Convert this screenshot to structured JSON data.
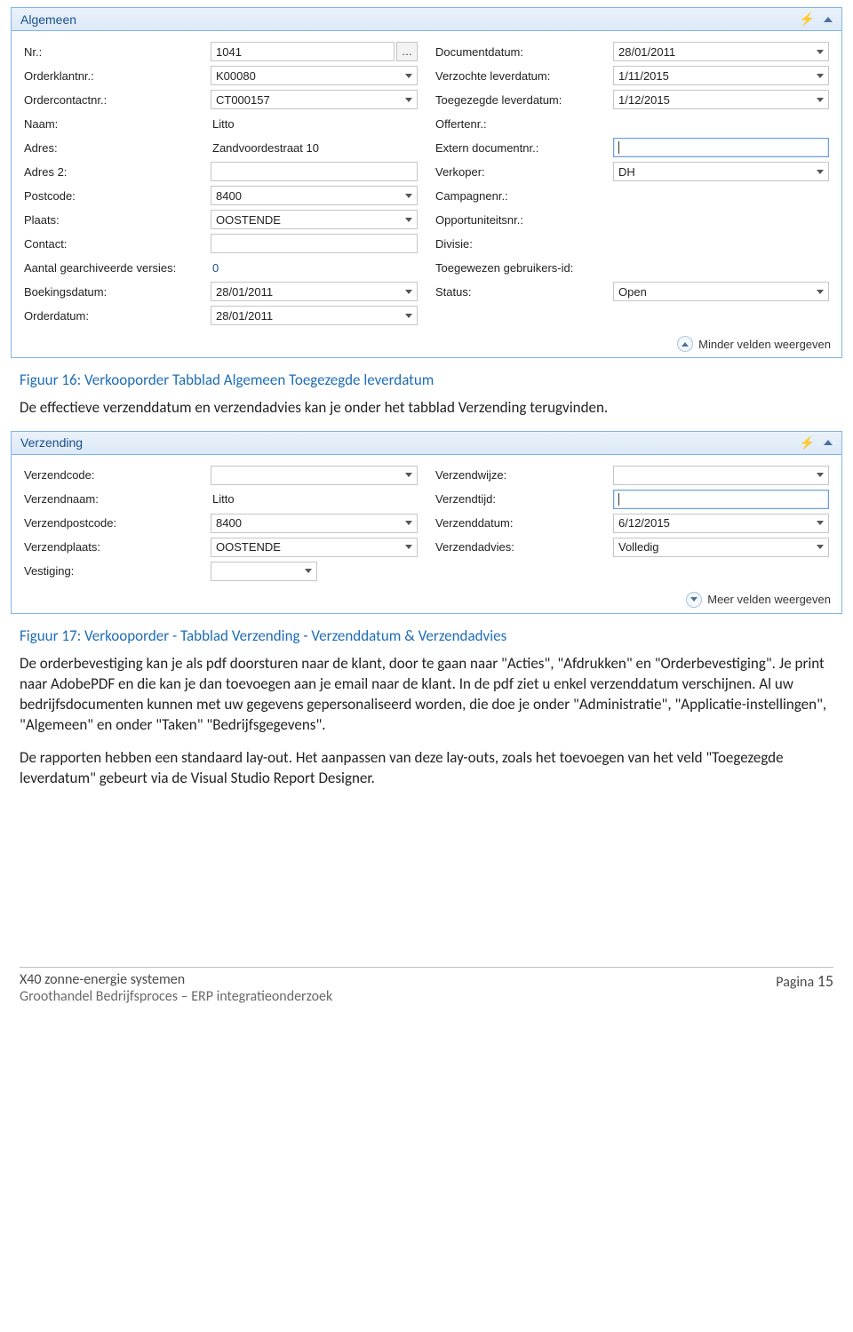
{
  "panel1": {
    "title": "Algemeen",
    "left": [
      {
        "label": "Nr.:",
        "value": "1041",
        "kind": "ellipsis-input"
      },
      {
        "label": "Orderklantnr.:",
        "value": "K00080",
        "kind": "dropdown"
      },
      {
        "label": "Ordercontactnr.:",
        "value": "CT000157",
        "kind": "dropdown"
      },
      {
        "label": "Naam:",
        "value": "Litto",
        "kind": "plain"
      },
      {
        "label": "Adres:",
        "value": "Zandvoordestraat 10",
        "kind": "plain"
      },
      {
        "label": "Adres 2:",
        "value": "",
        "kind": "input"
      },
      {
        "label": "Postcode:",
        "value": "8400",
        "kind": "dropdown"
      },
      {
        "label": "Plaats:",
        "value": "OOSTENDE",
        "kind": "dropdown"
      },
      {
        "label": "Contact:",
        "value": "",
        "kind": "input"
      },
      {
        "label": "Aantal gearchiveerde versies:",
        "value": "0",
        "kind": "link"
      },
      {
        "label": "Boekingsdatum:",
        "value": "28/01/2011",
        "kind": "dropdown"
      },
      {
        "label": "Orderdatum:",
        "value": "28/01/2011",
        "kind": "dropdown"
      }
    ],
    "right": [
      {
        "label": "Documentdatum:",
        "value": "28/01/2011",
        "kind": "dropdown"
      },
      {
        "label": "Verzochte leverdatum:",
        "value": "1/11/2015",
        "kind": "dropdown"
      },
      {
        "label": "Toegezegde leverdatum:",
        "value": "1/12/2015",
        "kind": "dropdown"
      },
      {
        "label": "Offertenr.:",
        "value": "",
        "kind": "plain"
      },
      {
        "label": "Extern documentnr.:",
        "value": "",
        "kind": "input-focused"
      },
      {
        "label": "Verkoper:",
        "value": "DH",
        "kind": "dropdown"
      },
      {
        "label": "Campagnenr.:",
        "value": "",
        "kind": "plain"
      },
      {
        "label": "Opportuniteitsnr.:",
        "value": "",
        "kind": "plain"
      },
      {
        "label": "Divisie:",
        "value": "",
        "kind": "plain"
      },
      {
        "label": "Toegewezen gebruikers-id:",
        "value": "",
        "kind": "plain"
      },
      {
        "label": "Status:",
        "value": "Open",
        "kind": "dropdown"
      }
    ],
    "footer_link": "Minder velden weergeven"
  },
  "caption1": "Figuur 16: Verkooporder Tabblad Algemeen Toegezegde leverdatum",
  "para1": "De effectieve verzenddatum en verzendadvies kan je onder het tabblad Verzending terugvinden.",
  "panel2": {
    "title": "Verzending",
    "left": [
      {
        "label": "Verzendcode:",
        "value": "",
        "kind": "dropdown"
      },
      {
        "label": "Verzendnaam:",
        "value": "Litto",
        "kind": "plain"
      },
      {
        "label": "Verzendpostcode:",
        "value": "8400",
        "kind": "dropdown"
      },
      {
        "label": "Verzendplaats:",
        "value": "OOSTENDE",
        "kind": "dropdown"
      },
      {
        "label": "Vestiging:",
        "value": "",
        "kind": "dropdown-narrow"
      }
    ],
    "right": [
      {
        "label": "Verzendwijze:",
        "value": "",
        "kind": "dropdown"
      },
      {
        "label": "Verzendtijd:",
        "value": "",
        "kind": "input-focused"
      },
      {
        "label": "Verzenddatum:",
        "value": "6/12/2015",
        "kind": "dropdown"
      },
      {
        "label": "Verzendadvies:",
        "value": "Volledig",
        "kind": "dropdown"
      }
    ],
    "footer_link": "Meer velden weergeven"
  },
  "caption2": "Figuur 17: Verkooporder - Tabblad Verzending - Verzenddatum & Verzendadvies",
  "para2": "De orderbevestiging kan je als pdf doorsturen naar de klant, door te gaan naar \"Acties\", \"Afdrukken\" en \"Orderbevestiging\". Je print naar AdobePDF en die kan je dan toevoegen aan je email naar de klant. In de pdf ziet u enkel verzenddatum verschijnen. Al uw bedrijfsdocumenten kunnen met uw gegevens gepersonaliseerd worden, die doe je onder \"Administratie\", \"Applicatie-instellingen\", \"Algemeen\" en onder \"Taken\" \"Bedrijfsgegevens\".",
  "para3": "De rapporten hebben een standaard lay-out. Het aanpassen van deze lay-outs, zoals het toevoegen van het veld \"Toegezegde leverdatum\" gebeurt via de Visual Studio Report Designer.",
  "footer": {
    "left1": "X40 zonne-energie systemen",
    "left2": "Groothandel Bedrijfsproces – ERP integratieonderzoek",
    "right_label": "Pagina ",
    "right_num": "15"
  }
}
